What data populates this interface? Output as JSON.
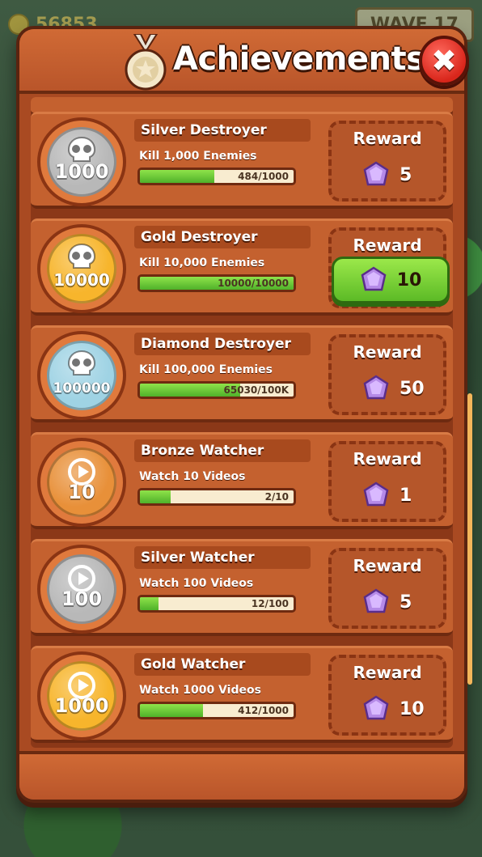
{
  "hud": {
    "coins": "56853",
    "wave_label": "WAVE",
    "wave_number": "17"
  },
  "panel": {
    "title": "Achievements",
    "close_label": "✖"
  },
  "achievements": [
    {
      "name": "Silver Destroyer",
      "desc": "Kill 1,000 Enemies",
      "progress_text": "484/1000",
      "progress": 0.484,
      "badge_num": "1000",
      "badge_type": "skull",
      "badge_color": "#b8b8b8",
      "reward_label": "Reward",
      "reward_amount": "5",
      "claimable": false
    },
    {
      "name": "Gold Destroyer",
      "desc": "Kill 10,000 Enemies",
      "progress_text": "10000/10000",
      "progress": 1.0,
      "badge_num": "10000",
      "badge_type": "skull",
      "badge_color": "#f7b52c",
      "reward_label": "Reward",
      "reward_amount": "10",
      "claimable": true
    },
    {
      "name": "Diamond Destroyer",
      "desc": "Kill 100,000 Enemies",
      "progress_text": "65030/100K",
      "progress": 0.6503,
      "badge_num": "100000",
      "badge_type": "skull",
      "badge_color": "#9fd3e4",
      "reward_label": "Reward",
      "reward_amount": "50",
      "claimable": false
    },
    {
      "name": "Bronze Watcher",
      "desc": "Watch 10 Videos",
      "progress_text": "2/10",
      "progress": 0.2,
      "badge_num": "10",
      "badge_type": "play",
      "badge_color": "#e89039",
      "reward_label": "Reward",
      "reward_amount": "1",
      "claimable": false
    },
    {
      "name": "Silver Watcher",
      "desc": "Watch 100 Videos",
      "progress_text": "12/100",
      "progress": 0.12,
      "badge_num": "100",
      "badge_type": "play",
      "badge_color": "#b8b8b8",
      "reward_label": "Reward",
      "reward_amount": "5",
      "claimable": false
    },
    {
      "name": "Gold Watcher",
      "desc": "Watch 1000 Videos",
      "progress_text": "412/1000",
      "progress": 0.412,
      "badge_num": "1000",
      "badge_type": "play",
      "badge_color": "#f7b52c",
      "reward_label": "Reward",
      "reward_amount": "10",
      "claimable": false
    }
  ]
}
